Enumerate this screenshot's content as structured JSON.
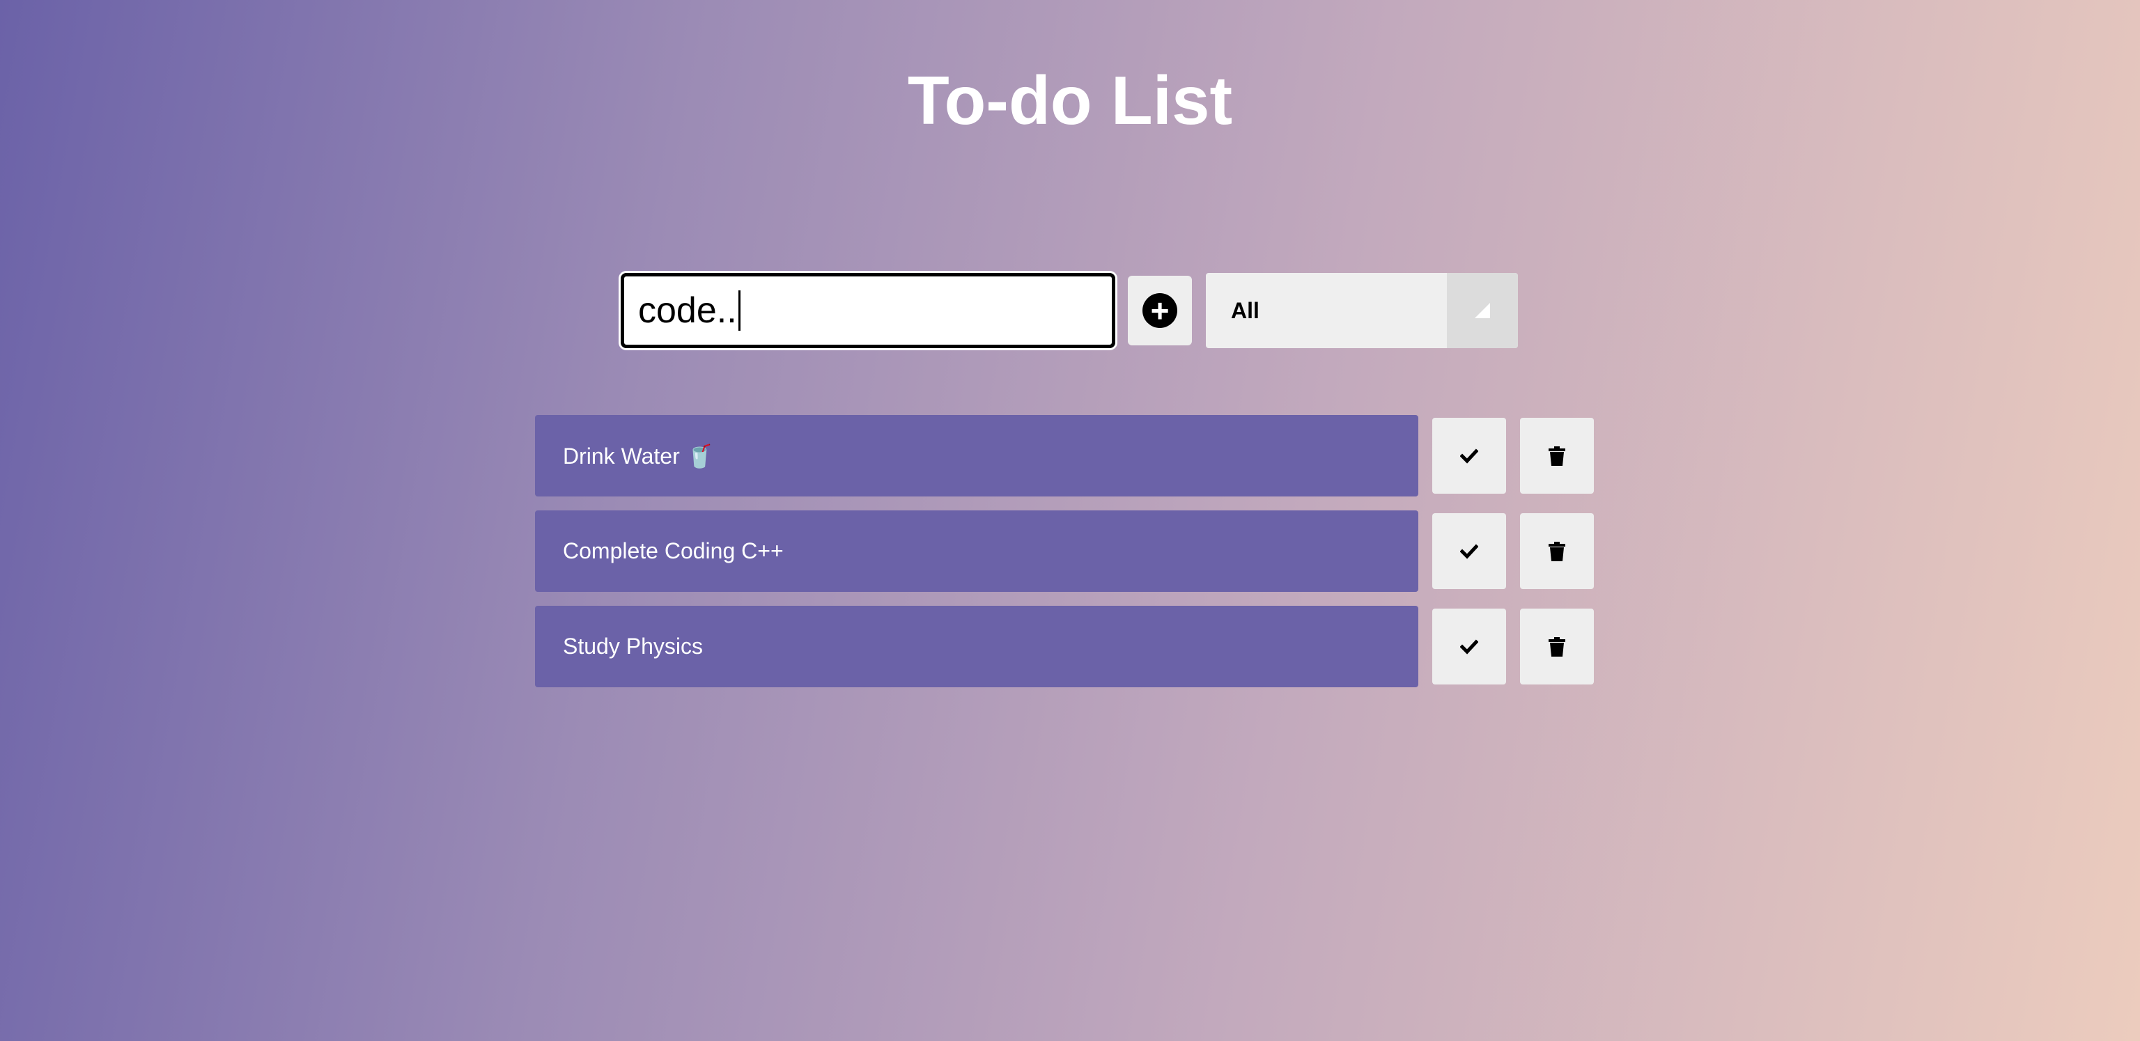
{
  "page": {
    "title": "To-do List"
  },
  "form": {
    "input_value": "code..",
    "add_icon": "plus-circle-icon",
    "filter": {
      "selected": "All",
      "arrow_icon": "triangle-icon"
    }
  },
  "todos": [
    {
      "text": "Drink Water 🥤",
      "complete_icon": "check-icon",
      "delete_icon": "trash-icon"
    },
    {
      "text": "Complete Coding C++",
      "complete_icon": "check-icon",
      "delete_icon": "trash-icon"
    },
    {
      "text": "Study Physics",
      "complete_icon": "check-icon",
      "delete_icon": "trash-icon"
    }
  ],
  "colors": {
    "item_bg": "#6b62a8",
    "button_bg": "#eeeeee",
    "gradient_start": "#6b62a8",
    "gradient_end": "#ecccbe"
  }
}
